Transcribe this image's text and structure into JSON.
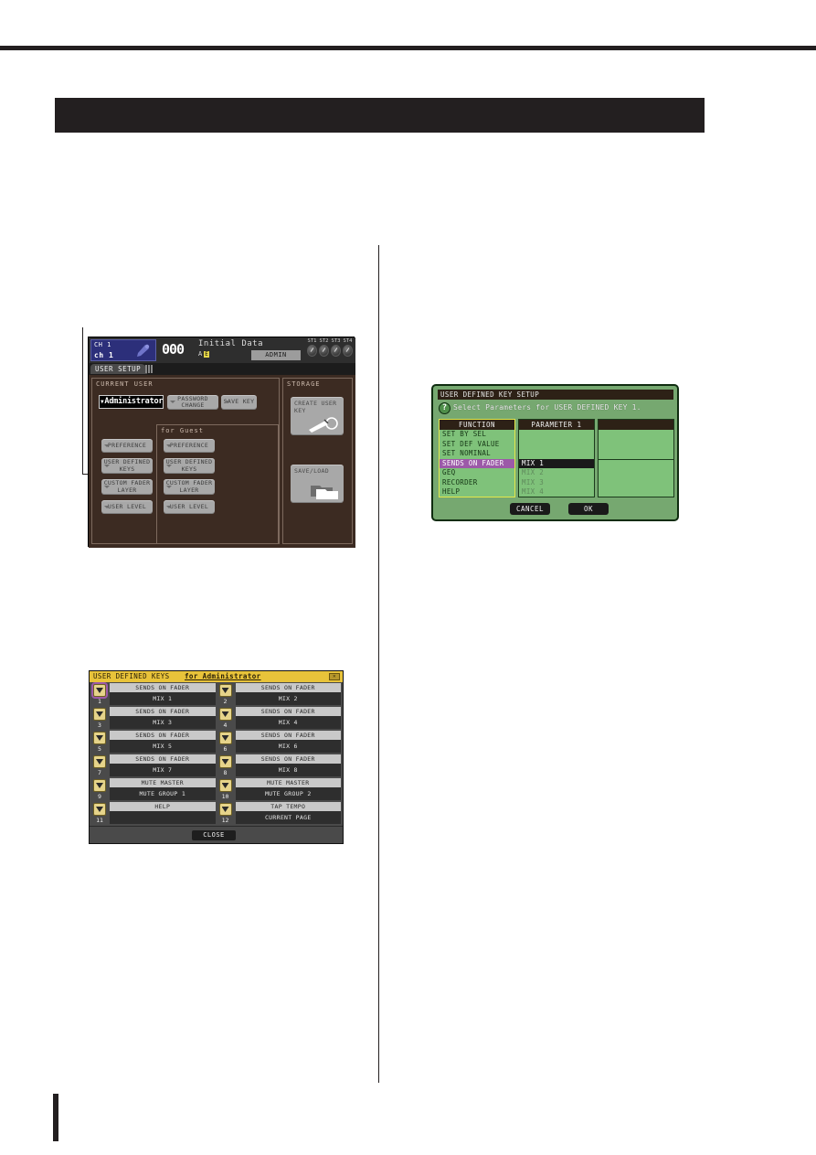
{
  "page": {
    "header_band_text": "",
    "page_marker_text": ""
  },
  "setup_screen": {
    "channel_strip": {
      "ch_label_top": "CH 1",
      "ch_label_bottom": "ch 1",
      "mic_icon": "microphone-icon",
      "scene_number": "000",
      "scene_name": "Initial Data",
      "scene_sub_left": "A",
      "scene_sub_badge": "E",
      "user_chip": "ADMIN",
      "st_labels": [
        "ST1",
        "ST2",
        "ST3",
        "ST4"
      ]
    },
    "tab": {
      "active_label": "USER SETUP"
    },
    "current_user_panel": {
      "title": "CURRENT USER",
      "selected_user": "Administrator",
      "password_change_label": "PASSWORD CHANGE",
      "save_key_label": "SAVE KEY",
      "admin_buttons": [
        {
          "label": "PREFERENCE"
        },
        {
          "label": "USER DEFINED KEYS"
        },
        {
          "label": "CUSTOM FADER LAYER"
        },
        {
          "label": "USER LEVEL"
        }
      ],
      "guest_title": "for Guest",
      "guest_buttons": [
        {
          "label": "PREFERENCE"
        },
        {
          "label": "USER DEFINED KEYS"
        },
        {
          "label": "CUSTOM FADER LAYER"
        },
        {
          "label": "USER LEVEL"
        }
      ]
    },
    "storage_panel": {
      "title": "STORAGE",
      "create_user_key_label": "CREATE USER KEY",
      "create_user_key_icon": "key-icon",
      "save_load_label": "SAVE/LOAD",
      "save_load_icon": "folder-icon"
    }
  },
  "udk_setup_dialog": {
    "title": "USER DEFINED KEY SETUP",
    "help_icon": "question-mark-icon",
    "message": "Select Parameters for USER DEFINED KEY 1.",
    "function_column": {
      "header": "FUNCTION",
      "items": [
        {
          "label": "SET BY SEL",
          "state": "normal"
        },
        {
          "label": "SET DEF VALUE",
          "state": "normal"
        },
        {
          "label": "SET NOMINAL",
          "state": "normal"
        },
        {
          "label": "SENDS ON FADER",
          "state": "selected"
        },
        {
          "label": "GEQ",
          "state": "normal"
        },
        {
          "label": "RECORDER",
          "state": "normal"
        },
        {
          "label": "HELP",
          "state": "normal"
        }
      ]
    },
    "parameter1_column": {
      "header": "PARAMETER 1",
      "items": [
        {
          "label": "",
          "state": "blank"
        },
        {
          "label": "",
          "state": "blank"
        },
        {
          "label": "",
          "state": "blank"
        },
        {
          "label": "MIX 1",
          "state": "selected"
        },
        {
          "label": "MIX 2",
          "state": "dim"
        },
        {
          "label": "MIX 3",
          "state": "dim"
        },
        {
          "label": "MIX 4",
          "state": "dim"
        }
      ]
    },
    "parameter2_column": {
      "header": "",
      "items": [
        {
          "label": "",
          "state": "blank"
        },
        {
          "label": "",
          "state": "blank"
        },
        {
          "label": "",
          "state": "blank"
        },
        {
          "label": "",
          "state": "blank"
        },
        {
          "label": "",
          "state": "blank"
        },
        {
          "label": "",
          "state": "blank"
        },
        {
          "label": "",
          "state": "blank"
        }
      ]
    },
    "cancel_label": "CANCEL",
    "ok_label": "OK"
  },
  "udk_panel": {
    "title": "USER DEFINED KEYS",
    "title_user": "for Administrator",
    "close_icon": "close-icon",
    "close_button_label": "CLOSE",
    "keys": [
      {
        "number": "1",
        "function": "SENDS ON FADER",
        "parameter": "MIX 1",
        "active": true
      },
      {
        "number": "2",
        "function": "SENDS ON FADER",
        "parameter": "MIX 2",
        "active": false
      },
      {
        "number": "3",
        "function": "SENDS ON FADER",
        "parameter": "MIX 3",
        "active": false
      },
      {
        "number": "4",
        "function": "SENDS ON FADER",
        "parameter": "MIX 4",
        "active": false
      },
      {
        "number": "5",
        "function": "SENDS ON FADER",
        "parameter": "MIX 5",
        "active": false
      },
      {
        "number": "6",
        "function": "SENDS ON FADER",
        "parameter": "MIX 6",
        "active": false
      },
      {
        "number": "7",
        "function": "SENDS ON FADER",
        "parameter": "MIX 7",
        "active": false
      },
      {
        "number": "8",
        "function": "SENDS ON FADER",
        "parameter": "MIX 8",
        "active": false
      },
      {
        "number": "9",
        "function": "MUTE MASTER",
        "parameter": "MUTE GROUP 1",
        "active": false
      },
      {
        "number": "10",
        "function": "MUTE MASTER",
        "parameter": "MUTE GROUP 2",
        "active": false
      },
      {
        "number": "11",
        "function": "HELP",
        "parameter": "",
        "active": false
      },
      {
        "number": "12",
        "function": "TAP TEMPO",
        "parameter": "CURRENT PAGE",
        "active": false
      }
    ]
  },
  "colors": {
    "ink": "#231f20",
    "setup_bg": "#3c2b22",
    "dialog_green": "#76a870",
    "list_green": "#7fc27a",
    "selection_purple": "#9c5aa8",
    "title_yellow": "#e8c33a",
    "channel_blue": "#2c2f7a"
  }
}
